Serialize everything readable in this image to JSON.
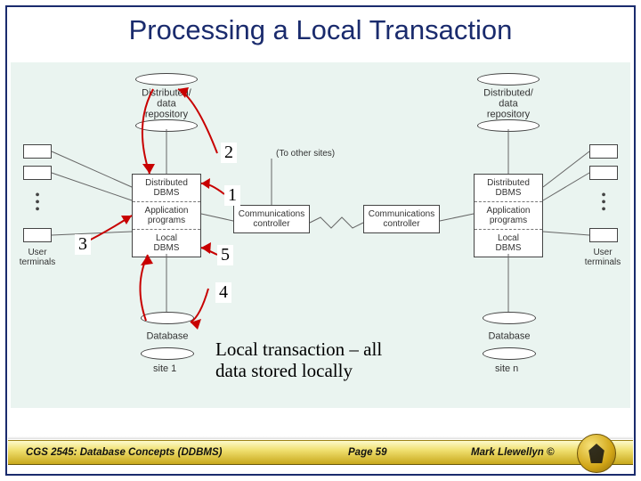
{
  "title": "Processing a Local Transaction",
  "diagram": {
    "repo_top_left": "Distributed/\ndata\nrepository",
    "repo_top_right": "Distributed/\ndata\nrepository",
    "stack_left": {
      "r1": "Distributed\nDBMS",
      "r2": "Application\nprograms",
      "r3": "Local\nDBMS"
    },
    "stack_right": {
      "r1": "Distributed\nDBMS",
      "r2": "Application\nprograms",
      "r3": "Local\nDBMS"
    },
    "comm_left": "Communications\ncontroller",
    "comm_right": "Communications\ncontroller",
    "to_other_sites": "(To other sites)",
    "db_left": "Database",
    "db_right": "Database",
    "site_left": "site 1",
    "site_right": "site n",
    "term_left": "User\nterminals",
    "term_right": "User\nterminals",
    "numbers": {
      "n1": "1",
      "n2": "2",
      "n3": "3",
      "n4": "4",
      "n5": "5"
    },
    "caption": "Local transaction – all\ndata stored locally"
  },
  "footer": {
    "course": "CGS 2545: Database Concepts  (DDBMS)",
    "page": "Page 59",
    "author": "Mark Llewellyn ©"
  }
}
